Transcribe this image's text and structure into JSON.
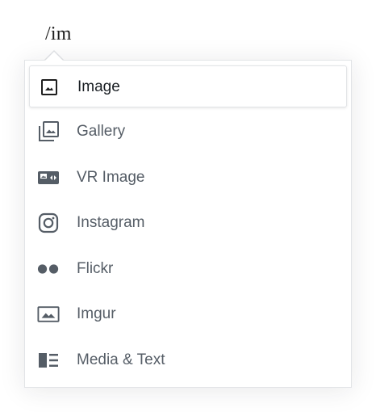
{
  "editor": {
    "slash_command": "/im"
  },
  "autocomplete": {
    "items": [
      {
        "label": "Image",
        "icon": "image-icon",
        "selected": true
      },
      {
        "label": "Gallery",
        "icon": "gallery-icon",
        "selected": false
      },
      {
        "label": "VR Image",
        "icon": "vr-image-icon",
        "selected": false
      },
      {
        "label": "Instagram",
        "icon": "instagram-icon",
        "selected": false
      },
      {
        "label": "Flickr",
        "icon": "flickr-icon",
        "selected": false
      },
      {
        "label": "Imgur",
        "icon": "imgur-icon",
        "selected": false
      },
      {
        "label": "Media & Text",
        "icon": "media-text-icon",
        "selected": false
      }
    ]
  },
  "colors": {
    "text_muted": "#555d66",
    "text_selected": "#191e23",
    "border": "#e2e4e7"
  }
}
